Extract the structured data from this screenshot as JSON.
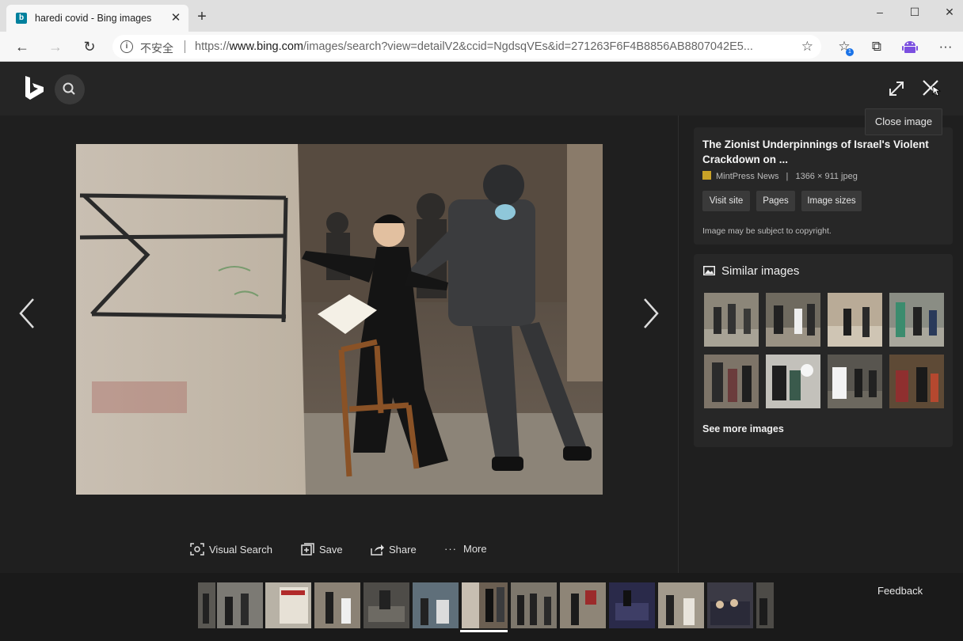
{
  "browser": {
    "tab": {
      "title": "haredi covid - Bing images",
      "favicon": "b"
    },
    "address": {
      "security_text": "不安全",
      "url_prefix": "https://",
      "url_domain": "www.bing.com",
      "url_path": "/images/search?view=detailV2&ccid=NgdsqVEs&id=271263F6F4B8856AB8807042E5..."
    },
    "window_controls": {
      "minimize": "–",
      "maximize": "☐",
      "close": "✕"
    }
  },
  "viewer": {
    "tooltip": "Close image",
    "actions": {
      "visual_search": "Visual Search",
      "save": "Save",
      "share": "Share",
      "more": "More"
    }
  },
  "details": {
    "title": "The Zionist Underpinnings of Israel's Violent Crackdown on ...",
    "source": "MintPress News",
    "separator": "|",
    "dimensions": "1366 × 911 jpeg",
    "buttons": {
      "visit": "Visit site",
      "pages": "Pages",
      "sizes": "Image sizes"
    },
    "copyright": "Image may be subject to copyright."
  },
  "similar": {
    "title": "Similar images",
    "see_more": "See more images"
  },
  "filmstrip": {
    "feedback": "Feedback",
    "selected_index": 5
  },
  "colors": {
    "accent_tab_favicon": "#00809d",
    "panel": "#272727",
    "background": "#1f1f1f"
  }
}
